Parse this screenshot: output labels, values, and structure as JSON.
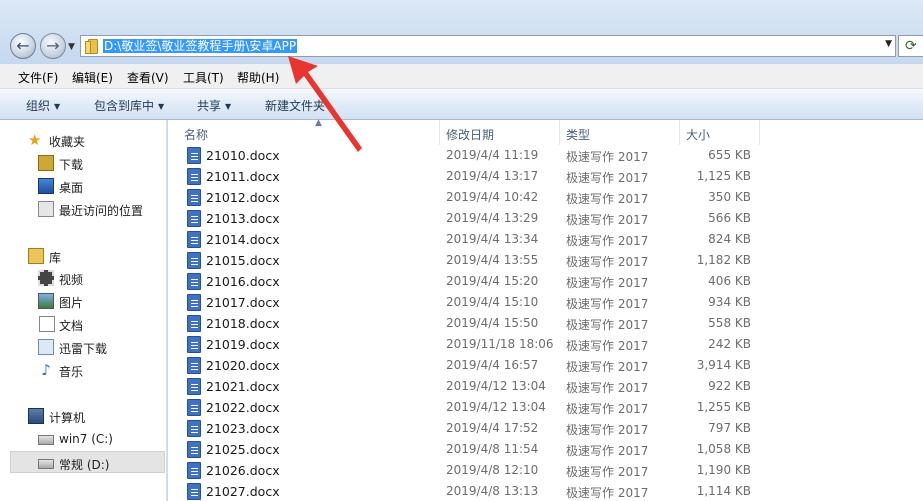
{
  "address": {
    "path": "D:\\敬业签\\敬业签教程手册\\安卓APP"
  },
  "menubar": {
    "items": [
      "文件(F)",
      "编辑(E)",
      "查看(V)",
      "工具(T)",
      "帮助(H)"
    ]
  },
  "toolbar": {
    "organize": "组织",
    "include_library": "包含到库中",
    "share": "共享",
    "new_folder": "新建文件夹"
  },
  "navpane": {
    "favorites": "收藏夹",
    "downloads": "下载",
    "desktop": "桌面",
    "recent": "最近访问的位置",
    "libraries": "库",
    "videos": "视频",
    "pictures": "图片",
    "documents": "文档",
    "xunlei": "迅雷下载",
    "music": "音乐",
    "computer": "计算机",
    "drive_c": "win7 (C:)",
    "drive_d": "常规 (D:)"
  },
  "columns": {
    "name": "名称",
    "modified": "修改日期",
    "type": "类型",
    "size": "大小"
  },
  "files": [
    {
      "name": "21010.docx",
      "modified": "2019/4/4 11:19",
      "type": "极速写作 2017",
      "size": "655 KB"
    },
    {
      "name": "21011.docx",
      "modified": "2019/4/4 13:17",
      "type": "极速写作 2017",
      "size": "1,125 KB"
    },
    {
      "name": "21012.docx",
      "modified": "2019/4/4 10:42",
      "type": "极速写作 2017",
      "size": "350 KB"
    },
    {
      "name": "21013.docx",
      "modified": "2019/4/4 13:29",
      "type": "极速写作 2017",
      "size": "566 KB"
    },
    {
      "name": "21014.docx",
      "modified": "2019/4/4 13:34",
      "type": "极速写作 2017",
      "size": "824 KB"
    },
    {
      "name": "21015.docx",
      "modified": "2019/4/4 13:55",
      "type": "极速写作 2017",
      "size": "1,182 KB"
    },
    {
      "name": "21016.docx",
      "modified": "2019/4/4 15:20",
      "type": "极速写作 2017",
      "size": "406 KB"
    },
    {
      "name": "21017.docx",
      "modified": "2019/4/4 15:10",
      "type": "极速写作 2017",
      "size": "934 KB"
    },
    {
      "name": "21018.docx",
      "modified": "2019/4/4 15:50",
      "type": "极速写作 2017",
      "size": "558 KB"
    },
    {
      "name": "21019.docx",
      "modified": "2019/11/18 18:06",
      "type": "极速写作 2017",
      "size": "242 KB"
    },
    {
      "name": "21020.docx",
      "modified": "2019/4/4 16:57",
      "type": "极速写作 2017",
      "size": "3,914 KB"
    },
    {
      "name": "21021.docx",
      "modified": "2019/4/12 13:04",
      "type": "极速写作 2017",
      "size": "922 KB"
    },
    {
      "name": "21022.docx",
      "modified": "2019/4/12 13:04",
      "type": "极速写作 2017",
      "size": "1,255 KB"
    },
    {
      "name": "21023.docx",
      "modified": "2019/4/4 17:52",
      "type": "极速写作 2017",
      "size": "797 KB"
    },
    {
      "name": "21025.docx",
      "modified": "2019/4/8 11:54",
      "type": "极速写作 2017",
      "size": "1,058 KB"
    },
    {
      "name": "21026.docx",
      "modified": "2019/4/8 12:10",
      "type": "极速写作 2017",
      "size": "1,190 KB"
    },
    {
      "name": "21027.docx",
      "modified": "2019/4/8 13:13",
      "type": "极速写作 2017",
      "size": "1,114 KB"
    }
  ],
  "colors": {
    "selection": "#3399ff",
    "annotation_arrow": "#e8352f",
    "doc_icon": "#3f72c4"
  }
}
